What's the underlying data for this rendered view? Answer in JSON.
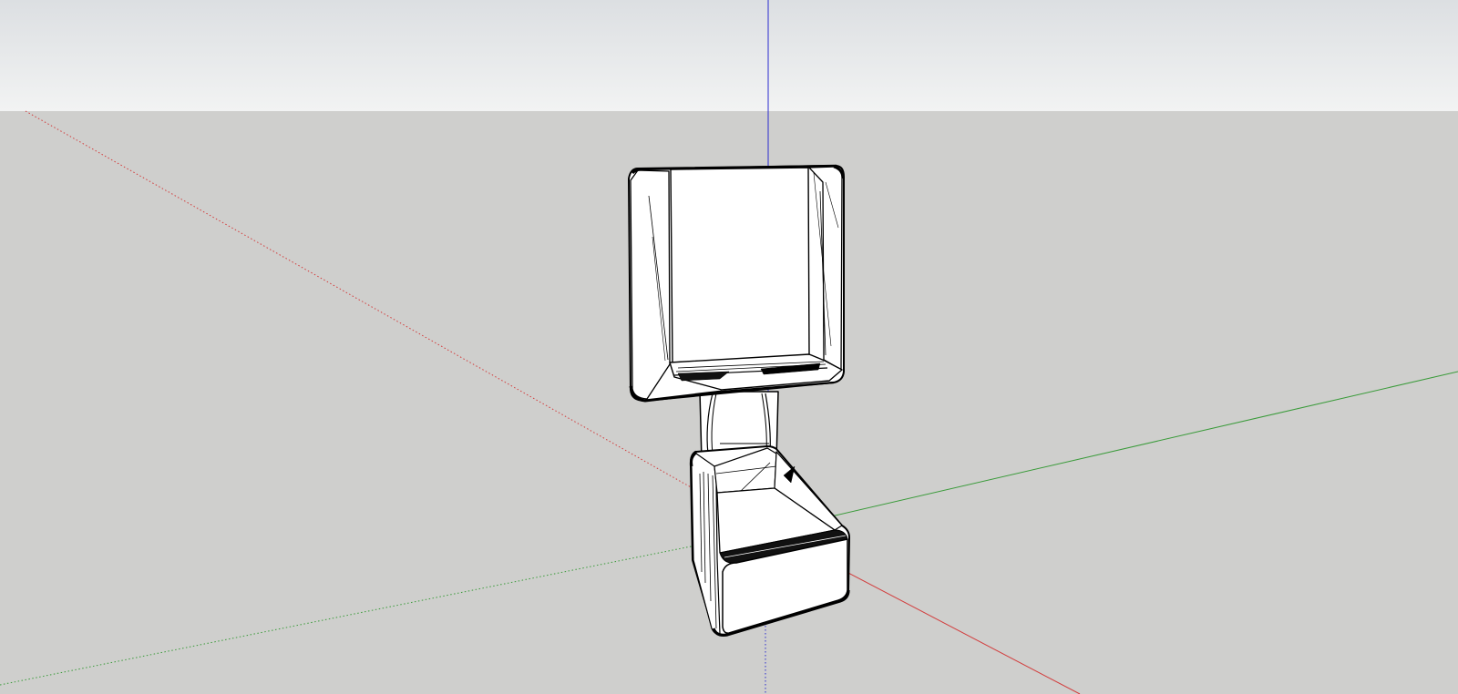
{
  "viewport": {
    "type": "3d-modeling-viewport",
    "colors": {
      "sky_top": "#dcdfe2",
      "sky_bottom": "#f2f3f3",
      "ground": "#cfcfcd",
      "axis_red": "#d23c3c",
      "axis_green": "#3a9b3a",
      "axis_blue": "#2c2ccf",
      "model_face": "#ffffff",
      "model_edge": "#000000"
    },
    "axes": [
      "red-axis",
      "green-axis",
      "blue-axis"
    ],
    "model": {
      "parts": [
        "upper-frame",
        "connector-stem",
        "base-block"
      ]
    }
  }
}
